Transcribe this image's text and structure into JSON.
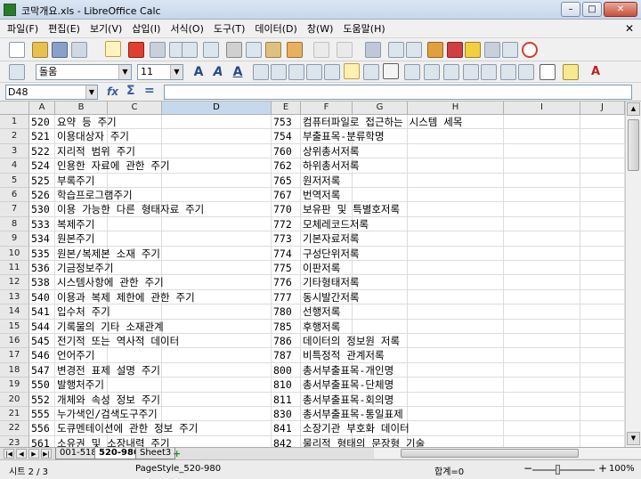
{
  "window": {
    "title": "코막개요.xls - LibreOffice Calc",
    "min": "–",
    "max": "□",
    "close": "✕"
  },
  "menu": [
    "파일(F)",
    "편집(E)",
    "보기(V)",
    "삽입(I)",
    "서식(O)",
    "도구(T)",
    "데이터(D)",
    "창(W)",
    "도움말(H)"
  ],
  "menu_close": "✕",
  "format": {
    "font_name": "돌움",
    "font_size": "11"
  },
  "formula": {
    "cell_ref": "D48",
    "fx": "fx",
    "sum": "Σ",
    "equals": "="
  },
  "columns": [
    "A",
    "B",
    "C",
    "D",
    "E",
    "F",
    "G",
    "H",
    "I",
    "J"
  ],
  "selected_column": "D",
  "rows": [
    {
      "n": "1",
      "a": "520",
      "b": "요약 등 주기",
      "e": "753",
      "f": "컴퓨터파일로 접근하는 시스템 세목"
    },
    {
      "n": "2",
      "a": "521",
      "b": "이용대상자 주기",
      "e": "754",
      "f": "부출표목-분류학명"
    },
    {
      "n": "3",
      "a": "522",
      "b": "지리적 범위 주기",
      "e": "760",
      "f": "상위총서저록"
    },
    {
      "n": "4",
      "a": "524",
      "b": "인용한 자료에 관한 주기",
      "e": "762",
      "f": "하위총서저록"
    },
    {
      "n": "5",
      "a": "525",
      "b": "부록주기",
      "e": "765",
      "f": "원저저록"
    },
    {
      "n": "6",
      "a": "526",
      "b": "학습프로그램주기",
      "e": "767",
      "f": "번역저록"
    },
    {
      "n": "7",
      "a": "530",
      "b": "이용 가능한 다른 형태자료 주기",
      "e": "770",
      "f": "보유판 및 특별호저록"
    },
    {
      "n": "8",
      "a": "533",
      "b": "복제주기",
      "e": "772",
      "f": "모체레코드저록"
    },
    {
      "n": "9",
      "a": "534",
      "b": "원본주기",
      "e": "773",
      "f": "기본자료저록"
    },
    {
      "n": "10",
      "a": "535",
      "b": "원본/복제본 소재 주기",
      "e": "774",
      "f": "구성단위저록"
    },
    {
      "n": "11",
      "a": "536",
      "b": "기금정보주기",
      "e": "775",
      "f": "이판저록"
    },
    {
      "n": "12",
      "a": "538",
      "b": "시스템사항에 관한 주기",
      "e": "776",
      "f": "기타형태저록"
    },
    {
      "n": "13",
      "a": "540",
      "b": "이용과 복제 제한에 관한 주기",
      "e": "777",
      "f": "동시발간저록"
    },
    {
      "n": "14",
      "a": "541",
      "b": "입수처 주기",
      "e": "780",
      "f": "선행저록"
    },
    {
      "n": "15",
      "a": "544",
      "b": "기록물의 기타 소재관계",
      "e": "785",
      "f": "후행저록"
    },
    {
      "n": "16",
      "a": "545",
      "b": "전기적 또는 역사적 데이터",
      "e": "786",
      "f": "데이터의 정보원 저록"
    },
    {
      "n": "17",
      "a": "546",
      "b": "언어주기",
      "e": "787",
      "f": "비특정적 관계저록"
    },
    {
      "n": "18",
      "a": "547",
      "b": "변경전 표제 설명 주기",
      "e": "800",
      "f": "총서부출표목-개인명"
    },
    {
      "n": "19",
      "a": "550",
      "b": "발행처주기",
      "e": "810",
      "f": "총서부출표목-단체명"
    },
    {
      "n": "20",
      "a": "552",
      "b": "개체와 속성 정보 주기",
      "e": "811",
      "f": "총서부출표목-회의명"
    },
    {
      "n": "21",
      "a": "555",
      "b": "누가색인/검색도구주기",
      "e": "830",
      "f": "총서부출표목-통일표제"
    },
    {
      "n": "22",
      "a": "556",
      "b": "도큐멘테이션에 관한 정보 주기",
      "e": "841",
      "f": "소장기관 부호화 데이터"
    },
    {
      "n": "23",
      "a": "561",
      "b": "소유권 및 소장내력 주기",
      "e": "842",
      "f": "물리적 형태의 문장형 기술"
    }
  ],
  "tabs": [
    "001-518",
    "520-980",
    "Sheet3"
  ],
  "active_tab": "520-980",
  "add_tab": "+",
  "status": {
    "sheet": "시트 2 / 3",
    "style": "PageStyle_520-980",
    "sum": "합계=0",
    "zoom": "100%",
    "zoom_minus": "−",
    "zoom_plus": "+"
  }
}
